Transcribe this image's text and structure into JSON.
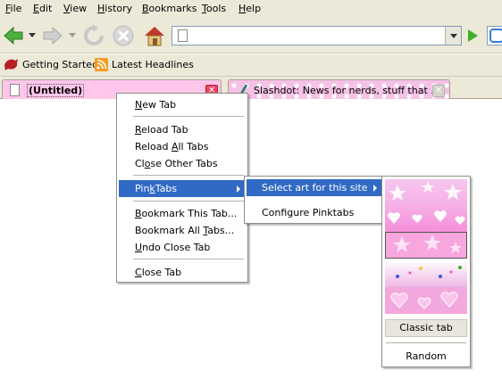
{
  "menubar": {
    "items": [
      {
        "accel": "F",
        "rest": "ile"
      },
      {
        "accel": "E",
        "rest": "dit"
      },
      {
        "accel": "V",
        "rest": "iew"
      },
      {
        "accel": "H",
        "rest": "istory"
      },
      {
        "accel": "B",
        "rest": "ookmarks"
      },
      {
        "accel": "T",
        "rest": "ools"
      },
      {
        "accel": "H",
        "rest": "elp"
      }
    ]
  },
  "navbar": {
    "back_icon": "back-arrow-icon",
    "forward_icon": "forward-arrow-icon",
    "reload_icon": "reload-icon",
    "stop_icon": "stop-icon",
    "home_icon": "home-icon",
    "url_value": "",
    "go_icon": "go-arrow-icon"
  },
  "bookmarks": {
    "items": [
      {
        "label": "Getting Started",
        "icon": "red-bird-icon"
      },
      {
        "label": "Latest Headlines",
        "icon": "rss-feed-icon"
      }
    ]
  },
  "tabs": [
    {
      "title": "(Untitled)",
      "selected": true
    },
    {
      "title": "Slashdot: News for nerds, stuff that …",
      "selected": false
    }
  ],
  "context_menu": {
    "items": {
      "new_tab": {
        "pre": "",
        "accel": "N",
        "post": "ew Tab"
      },
      "reload_tab": {
        "pre": "",
        "accel": "R",
        "post": "eload Tab"
      },
      "reload_all": {
        "pre": "Reload ",
        "accel": "A",
        "post": "ll Tabs"
      },
      "close_other": {
        "pre": "Cl",
        "accel": "o",
        "post": "se Other Tabs"
      },
      "pinktabs": {
        "pre": "Pin",
        "accel": "k",
        "post": "Tabs"
      },
      "bookmark_this": {
        "pre": "",
        "accel": "B",
        "post": "ookmark This Tab..."
      },
      "bookmark_all": {
        "pre": "Bookmark All ",
        "accel": "T",
        "post": "abs..."
      },
      "undo_close": {
        "pre": "",
        "accel": "U",
        "post": "ndo Close Tab"
      },
      "close_tab": {
        "pre": "",
        "accel": "C",
        "post": "lose Tab"
      }
    }
  },
  "pinktabs_menu": {
    "select_art": "Select art for this site",
    "configure": "Configure Pinktabs"
  },
  "art_menu": {
    "classic_tab": "Classic tab",
    "random": "Random"
  },
  "colors": {
    "highlight": "#316ac5",
    "chrome": "#ece9d8",
    "pink_tab": "#ffc6ea",
    "close_red": "#e6475f"
  }
}
